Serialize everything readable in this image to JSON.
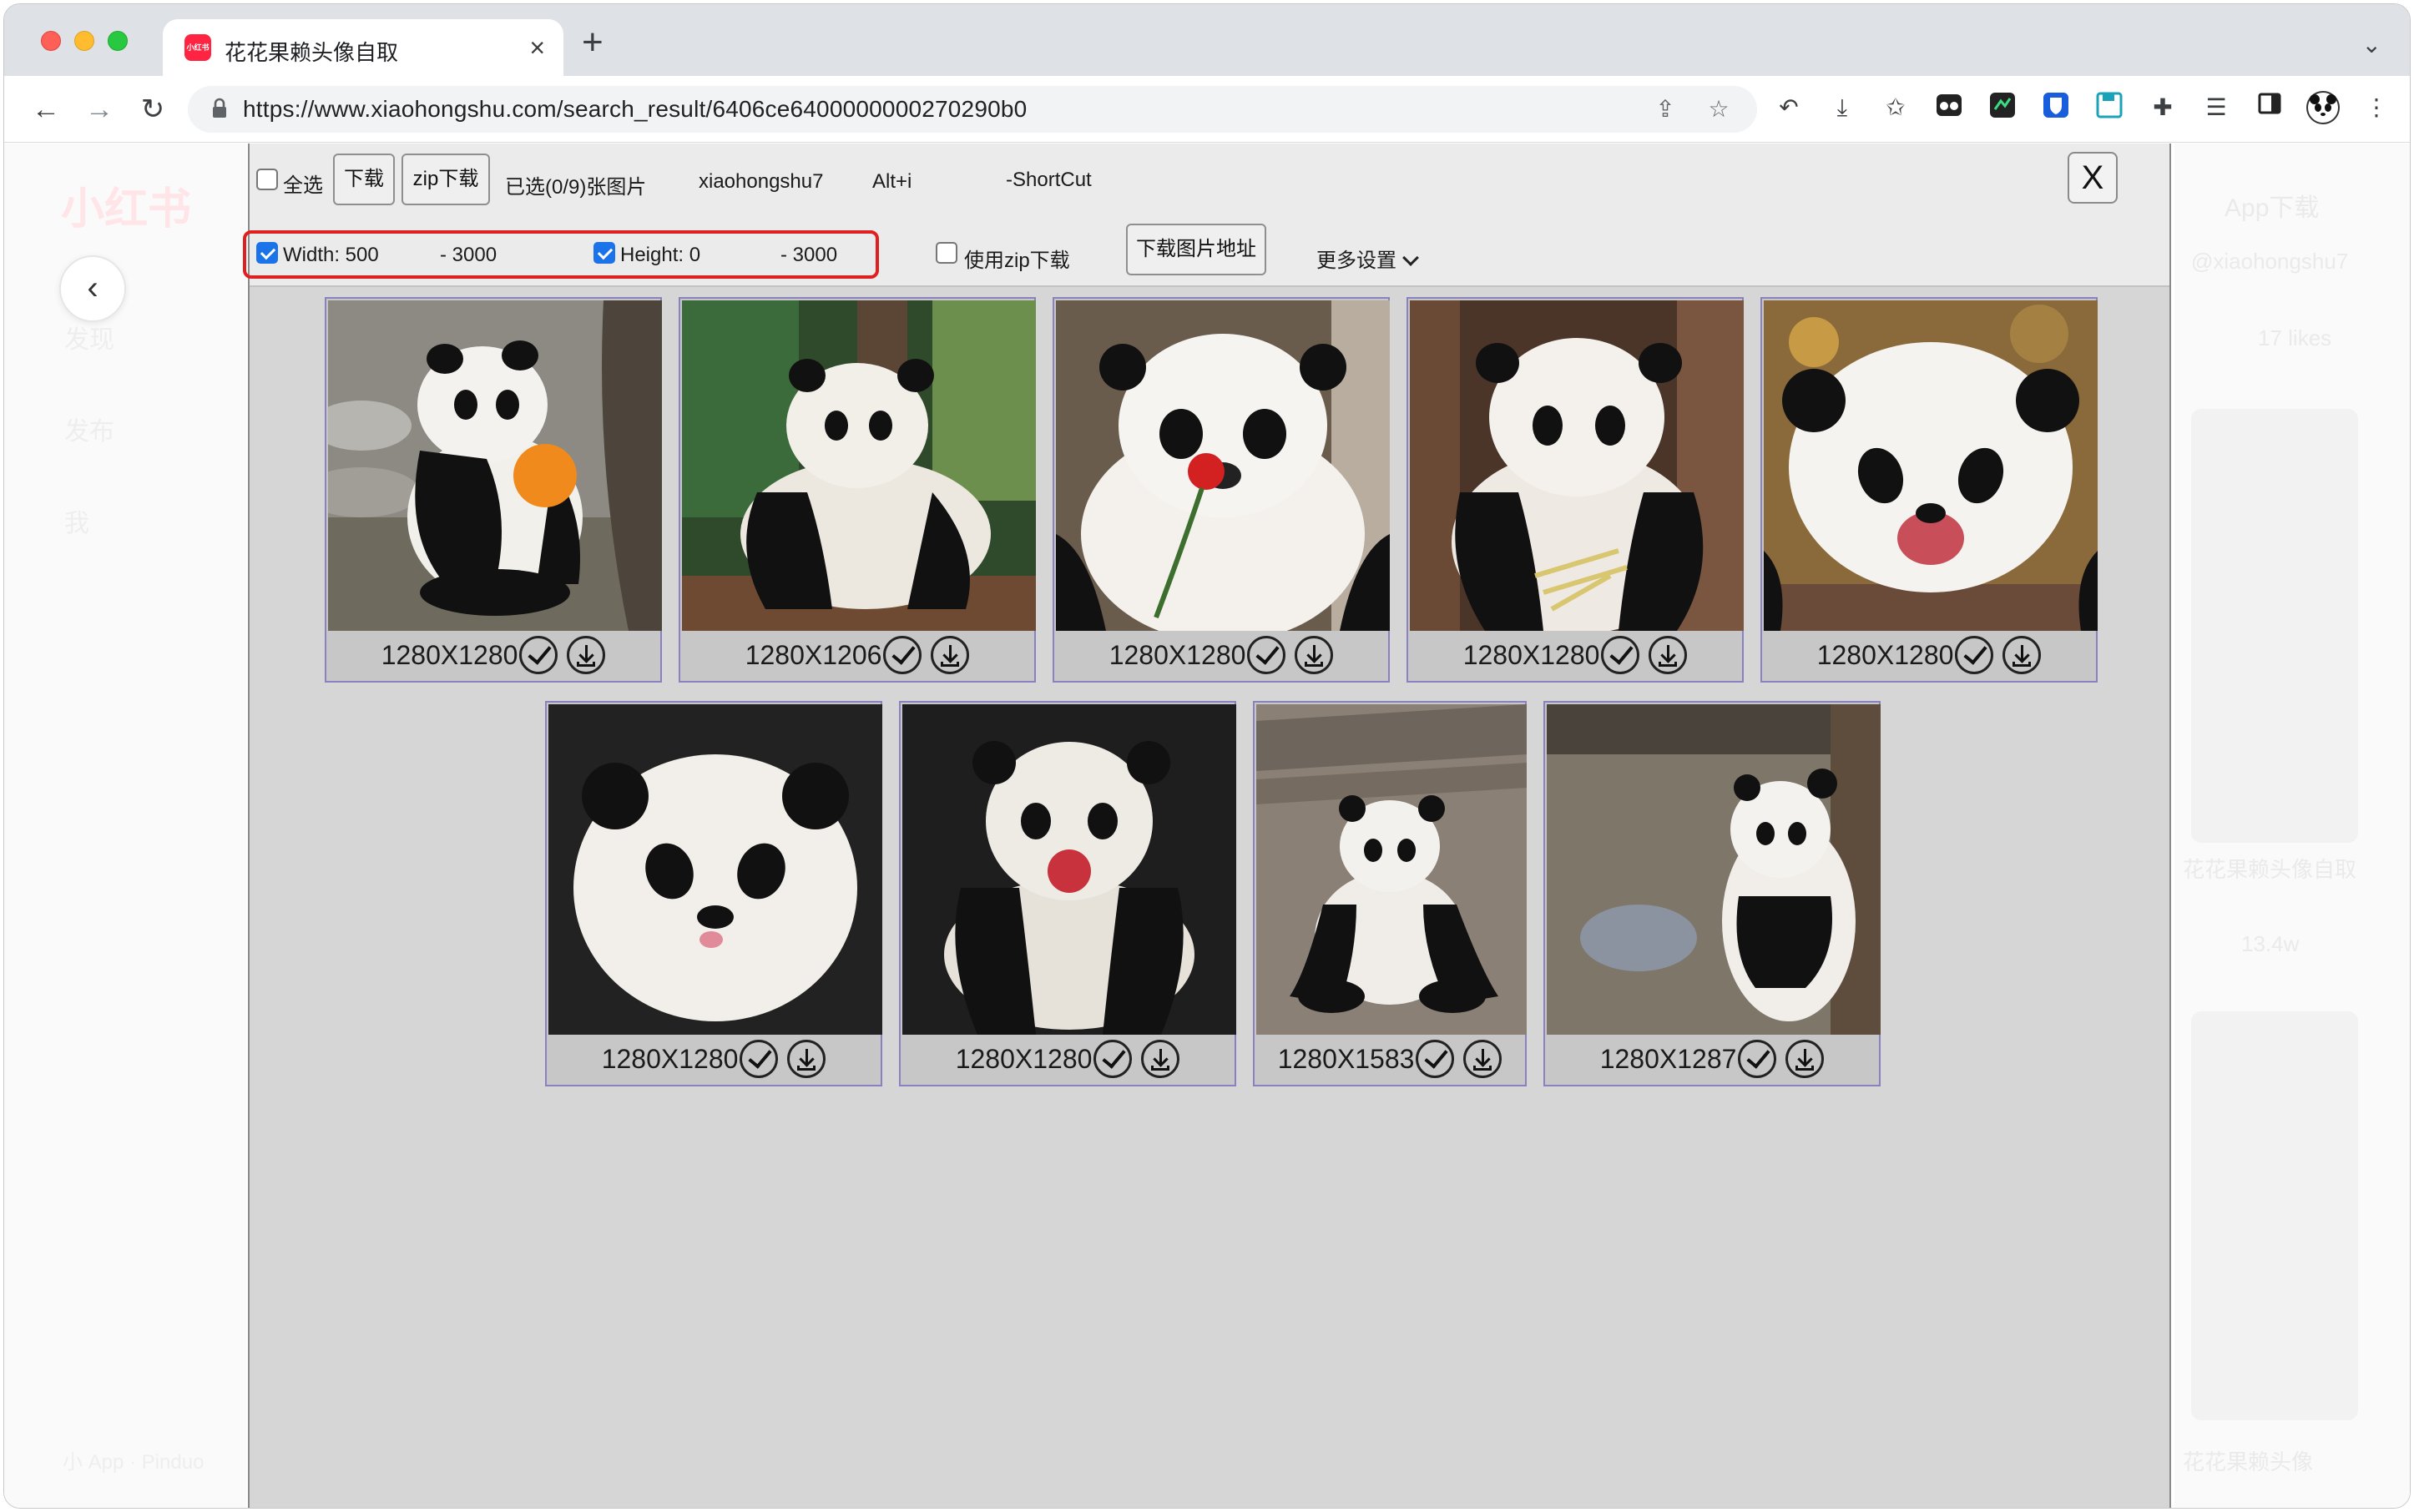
{
  "browser": {
    "tab_title": "花花果赖头像自取",
    "tab_favicon_text": "小红书",
    "url": "https://www.xiaohongshu.com/search_result/6406ce6400000000270290b0"
  },
  "background_page": {
    "logo": "小红书",
    "nav": [
      "发现",
      "发布",
      "我"
    ],
    "right_items": [
      "App下载",
      "@xiaohongshu7",
      "17 likes",
      "花花果赖头像自取",
      "花花果赖头像",
      "13.4w"
    ],
    "footer": "小 App · Pinduo"
  },
  "overlay": {
    "select_all_label": "全选",
    "download_button": "下载",
    "zip_download_button": "zip下载",
    "selected_count": "已选(0/9)张图片",
    "username": "xiaohongshu7",
    "shortcut_key": "Alt+i",
    "shortcut_label": "-ShortCut",
    "close_button": "X",
    "filters": {
      "width_checked": true,
      "width_label": "Width: 500",
      "width_max": "- 3000",
      "height_checked": true,
      "height_label": "Height: 0",
      "height_max": "- 3000"
    },
    "use_zip_checked": false,
    "use_zip_label": "使用zip下载",
    "download_urls_button": "下载图片地址",
    "more_settings": "更多设置"
  },
  "images": [
    {
      "size": "1280X1280",
      "scene": "orange"
    },
    {
      "size": "1280X1206",
      "scene": "forest"
    },
    {
      "size": "1280X1280",
      "scene": "flower"
    },
    {
      "size": "1280X1280",
      "scene": "bamboo"
    },
    {
      "size": "1280X1280",
      "scene": "smile"
    },
    {
      "size": "1280X1280",
      "scene": "portrait"
    },
    {
      "size": "1280X1280",
      "scene": "apple"
    },
    {
      "size": "1280X1583",
      "scene": "sitting"
    },
    {
      "size": "1280X1287",
      "scene": "tree"
    }
  ],
  "colors": {
    "accent_red": "#e02020",
    "checkbox_blue": "#1a73e8",
    "card_border": "#8a82c0",
    "xhs_red": "#ff2442"
  }
}
